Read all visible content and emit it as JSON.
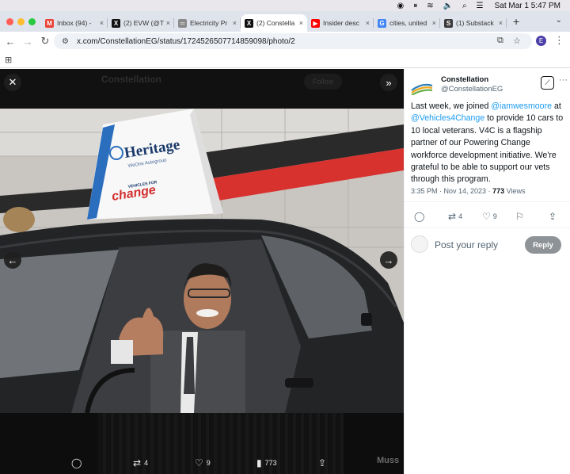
{
  "menubar": {
    "datetime": "Sat Mar 1  5:47 PM"
  },
  "tabs": [
    {
      "title": "Inbox (94) -",
      "icon": "gmail-icon",
      "color": "#ea4335",
      "glyph": "M"
    },
    {
      "title": "(2) EVW (@T",
      "icon": "x-logo-icon",
      "color": "#111111",
      "glyph": "X"
    },
    {
      "title": "Electricity Pr",
      "icon": "site-icon",
      "color": "#8a8a8a",
      "glyph": "═"
    },
    {
      "title": "(2) Constella",
      "icon": "x-logo-icon",
      "color": "#111111",
      "glyph": "X"
    },
    {
      "title": "Insider desc",
      "icon": "youtube-icon",
      "color": "#ff0000",
      "glyph": "▶"
    },
    {
      "title": "cities, united",
      "icon": "google-icon",
      "color": "#4285f4",
      "glyph": "G"
    },
    {
      "title": "(1) Substack",
      "icon": "substack-icon",
      "color": "#3b3b3b",
      "glyph": "S"
    }
  ],
  "address": {
    "url": "x.com/ConstellationEG/status/1724526507714859098/photo/2",
    "profile_initial": "E"
  },
  "viewer": {
    "ghost_name": "Constellation",
    "ghost_follow": "Follow",
    "replies": "",
    "retweets": "4",
    "likes": "9",
    "views": "773",
    "peek_text": "Muss"
  },
  "photo": {
    "sign_brand": "Heritage",
    "sign_sub": "WeOne Autogroup",
    "sign_program_top": "VEHICLES FOR",
    "sign_program": "change"
  },
  "tweet": {
    "name": "Constellation",
    "handle": "@ConstellationEG",
    "text_1": "Last week, we joined ",
    "mention_1": "@iamwesmoore",
    "text_2": " at ",
    "mention_2": "@Vehicles4Change",
    "text_3": " to provide 10 cars to 10 local veterans. V4C is a flagship partner of our Powering Change workforce development initiative. We're grateful to be able to support our vets through this program.",
    "time": "3:35 PM · Nov 14, 2023 · ",
    "views": "773",
    "views_label": " Views",
    "retweets": "4",
    "likes": "9",
    "reply_placeholder": "Post your reply",
    "reply_button": "Reply"
  }
}
